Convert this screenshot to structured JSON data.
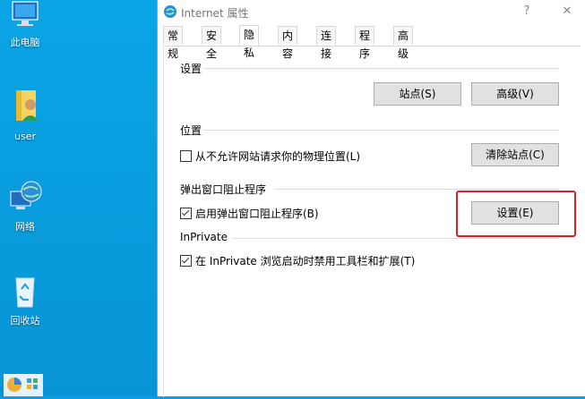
{
  "desktop": {
    "icons": [
      {
        "label": "此电脑"
      },
      {
        "label": "user"
      },
      {
        "label": "网络"
      },
      {
        "label": "回收站"
      }
    ]
  },
  "dialog": {
    "title": "Internet 属性",
    "help_glyph": "?",
    "close_glyph": "✕",
    "tabs": [
      {
        "label": "常规"
      },
      {
        "label": "安全"
      },
      {
        "label": "隐私"
      },
      {
        "label": "内容"
      },
      {
        "label": "连接"
      },
      {
        "label": "程序"
      },
      {
        "label": "高级"
      }
    ],
    "active_tab": "隐私",
    "settings": {
      "group_label": "设置",
      "sites_button": "站点(S)",
      "advanced_button": "高级(V)"
    },
    "location": {
      "group_label": "位置",
      "checkbox_label": "从不允许网站请求你的物理位置(L)",
      "checked": false,
      "clear_button": "清除站点(C)"
    },
    "popup_blocker": {
      "group_label": "弹出窗口阻止程序",
      "checkbox_label": "启用弹出窗口阻止程序(B)",
      "checked": true,
      "settings_button": "设置(E)"
    },
    "inprivate": {
      "group_label": "InPrivate",
      "checkbox_label": "在 InPrivate 浏览启动时禁用工具栏和扩展(T)",
      "checked": true
    }
  },
  "annotation": {
    "color": "#e02020"
  }
}
